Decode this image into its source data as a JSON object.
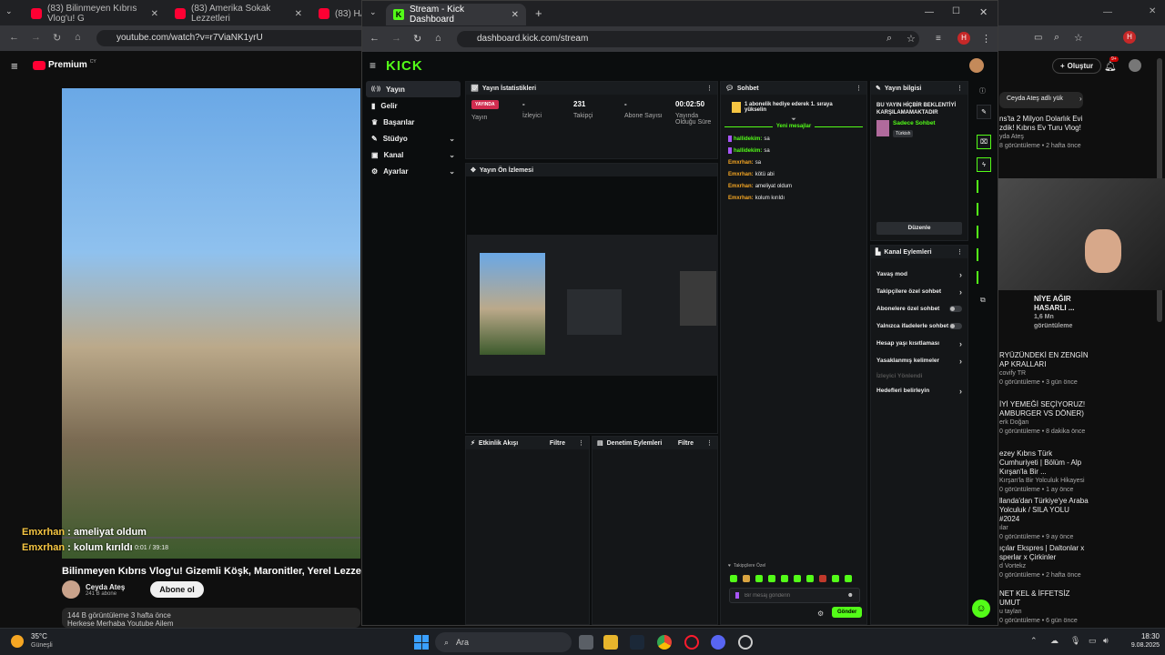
{
  "youtube": {
    "tabs": [
      "(83) Bilinmeyen Kıbrıs Vlog'u! G",
      "(83) Amerika Sokak Lezzetleri",
      "(83) HAV"
    ],
    "url": "youtube.com/watch?v=r7ViaNK1yrU",
    "premium_label": "Premium",
    "premium_badge": "CY",
    "overlay_chat": [
      {
        "name": "Emxrhan",
        "text": ": ameliyat oldum"
      },
      {
        "name": "Emxrhan",
        "text": ": kolum kırıldı"
      }
    ],
    "time": "0:01 / 39:18",
    "video_title": "Bilinmeyen Kıbrıs Vlog'u! Gizemli Köşk, Maronitler, Yerel Lezzetler!",
    "channel_name": "Ceyda Ateş",
    "subscribers": "241 B abone",
    "subscribe_label": "Abone ol",
    "desc_meta": "144 B görüntüleme  3 hafta önce",
    "desc_line": "Herkese Merhaba Youtube Ailem",
    "create_label": "Oluştur",
    "notif_count": "9+",
    "chip_label": "Ceyda Ateş adlı yük",
    "recommended": [
      {
        "title": "ns'ta 2 Milyon Dolarlık Evi zdik! Kıbrıs Ev Turu Vlog!",
        "meta": "yda Ateş",
        "stats": "8 görüntüleme • 2 hafta önce"
      },
      {
        "title": "NİYE AĞIR HASARLI ...",
        "meta": "1,6 Mn görüntüleme",
        "stats": ""
      },
      {
        "title": "RYÜZÜNDEKİ EN ZENGİN AP KRALLARI",
        "meta": "covify TR",
        "stats": "0 görüntüleme • 3 gün önce"
      },
      {
        "title": "İYİ YEMEĞİ SEÇİYORUZ! AMBURGER VS DÖNER)",
        "meta": "erk Doğan",
        "stats": "0 görüntüleme • 8 dakika önce"
      },
      {
        "title": "ezey Kıbrıs Türk Cumhuriyeti | Bölüm - Alp Kırşan'la Bir ...",
        "meta": "Kırşan'la Bir Yolculuk Hikayesi",
        "stats": "0 görüntüleme • 1 ay önce"
      },
      {
        "title": "llanda'dan Türkiye'ye Araba Yolculuk / SILA YOLU #2024",
        "meta": "ılar",
        "stats": "0 görüntüleme • 9 ay önce"
      },
      {
        "title": "ıçılar Ekspres | Daltonlar x sperlar x Çirkinler",
        "meta": "d Vortekz",
        "stats": "0 görüntüleme • 2 hafta önce"
      },
      {
        "title": "NET KEL & İFFETSİZ UMUT",
        "meta": "u taylan",
        "stats": "0 görüntüleme • 6 gün önce"
      }
    ]
  },
  "kick": {
    "tab_title": "Stream - Kick Dashboard",
    "url": "dashboard.kick.com/stream",
    "profile_initial": "H",
    "logo": "KICK",
    "nav": [
      {
        "label": "Yayın",
        "active": true,
        "icon": "broadcast-icon",
        "glyph": "((·))",
        "expand": false
      },
      {
        "label": "Gelir",
        "active": false,
        "icon": "wallet-icon",
        "glyph": "▮",
        "expand": false
      },
      {
        "label": "Başarılar",
        "active": false,
        "icon": "trophy-icon",
        "glyph": "♛",
        "expand": false
      },
      {
        "label": "Stüdyo",
        "active": false,
        "icon": "studio-icon",
        "glyph": "✎",
        "expand": true
      },
      {
        "label": "Kanal",
        "active": false,
        "icon": "channel-icon",
        "glyph": "▣",
        "expand": true
      },
      {
        "label": "Ayarlar",
        "active": false,
        "icon": "settings-icon",
        "glyph": "⚙",
        "expand": true
      }
    ],
    "stats_panel": {
      "title": "Yayın İstatistikleri",
      "live_badge": "YAYINDA",
      "items": [
        {
          "value": "",
          "label": "Yayın"
        },
        {
          "value": "-",
          "label": "İzleyici"
        },
        {
          "value": "231",
          "label": "Takipçi"
        },
        {
          "value": "-",
          "label": "Abone Sayısı"
        },
        {
          "value": "00:02:50",
          "label": "Yayında Olduğu Süre"
        }
      ]
    },
    "preview_title": "Yayın Ön İzlemesi",
    "activity_title": "Etkinlik Akışı",
    "activity_filter": "Filtre",
    "mod_title": "Denetim Eylemleri",
    "mod_filter": "Filtre",
    "chat": {
      "title": "Sohbet",
      "gift_banner": "1 abonelik hediye ederek 1. sıraya yükselin",
      "new_messages": "Yeni mesajlar",
      "messages": [
        {
          "user": "hallidekim:",
          "text": "sa",
          "color": "green",
          "badge": true
        },
        {
          "user": "hallidekim:",
          "text": "sa",
          "color": "green",
          "badge": true
        },
        {
          "user": "Emxrhan:",
          "text": "sa",
          "color": "orange",
          "badge": false
        },
        {
          "user": "Emxrhan:",
          "text": "kötü abi",
          "color": "orange",
          "badge": false
        },
        {
          "user": "Emxrhan:",
          "text": "ameliyat oldum",
          "color": "orange",
          "badge": false
        },
        {
          "user": "Emxrhan:",
          "text": "kolum kırıldı",
          "color": "orange",
          "badge": false
        }
      ],
      "followers_only": "Takipçilere Özel",
      "placeholder": "Bir mesaj gönderin",
      "send_label": "Gönder"
    },
    "info_panel": {
      "title": "Yayın bilgisi",
      "stream_title": "BU YAYIN HİÇBİR BEKLENTİYİ KARŞILAMAMAKTADIR",
      "category": "Sadece Sohbet",
      "language": "Türkish",
      "edit_label": "Düzenle"
    },
    "channel_actions": {
      "title": "Kanal Eylemleri",
      "items": [
        {
          "label": "Yavaş mod",
          "type": "arrow",
          "disabled": false
        },
        {
          "label": "Takipçilere özel sohbet",
          "type": "arrow",
          "disabled": false
        },
        {
          "label": "Abonelere özel sohbet",
          "type": "toggle",
          "disabled": false
        },
        {
          "label": "Yalnızca ifadelerle sohbet",
          "type": "toggle",
          "disabled": false
        },
        {
          "label": "Hesap yaşı kısıtlaması",
          "type": "arrow",
          "disabled": false
        },
        {
          "label": "Yasaklanmış kelimeler",
          "type": "arrow",
          "disabled": false
        },
        {
          "label": "İzleyici Yönlendi",
          "type": "none",
          "disabled": true
        },
        {
          "label": "Hedefleri belirleyin",
          "type": "arrow",
          "disabled": false
        }
      ]
    }
  },
  "taskbar": {
    "weather_temp": "35°C",
    "weather_desc": "Güneşli",
    "search_label": "Ara",
    "time": "18:30",
    "date": "9.08.2025"
  },
  "colors": {
    "kick_green": "#53fc18",
    "youtube_red": "#ff0033",
    "live_red": "#d12c4f"
  }
}
